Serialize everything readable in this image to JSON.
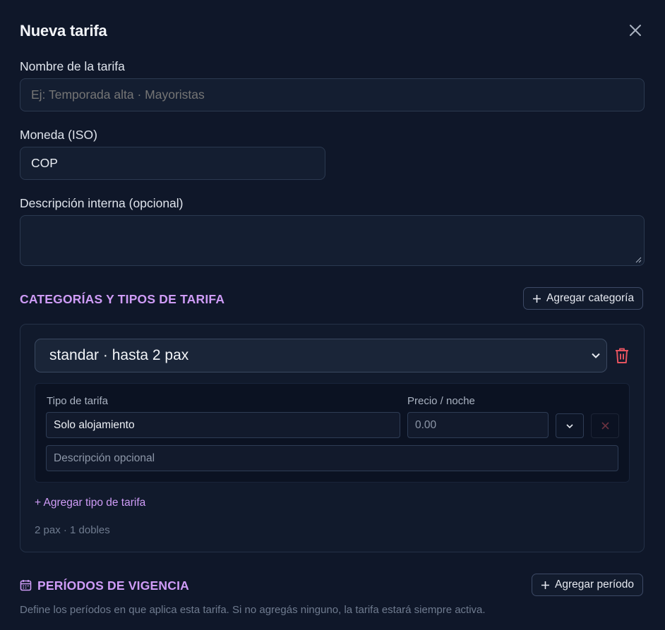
{
  "modal": {
    "title": "Nueva tarifa"
  },
  "form": {
    "name_label": "Nombre de la tarifa",
    "name_value": "",
    "name_placeholder": "Ej: Temporada alta · Mayoristas",
    "currency_label": "Moneda (ISO)",
    "currency_value": "COP",
    "description_label": "Descripción interna (opcional)",
    "description_value": ""
  },
  "categories": {
    "title": "CATEGORÍAS Y TIPOS DE TARIFA",
    "add_label": "Agregar categoría",
    "selected": "standar · hasta 2 pax",
    "rate_type_label": "Tipo de tarifa",
    "price_label": "Precio / noche",
    "rate_type_value": "Solo alojamiento",
    "price_value": "",
    "price_placeholder": "0.00",
    "rate_desc_value": "",
    "rate_desc_placeholder": "Descripción opcional",
    "add_rate_type": "+ Agregar tipo de tarifa",
    "summary": "2 pax · 1 dobles"
  },
  "periods": {
    "title": "PERÍODOS DE VIGENCIA",
    "add_label": "Agregar período",
    "help": "Define los períodos en que aplica esta tarifa. Si no agregás ninguno, la tarifa estará siempre activa."
  },
  "colors": {
    "background": "#0f1729",
    "accent": "#cf9cf7",
    "danger": "#e5535f"
  }
}
